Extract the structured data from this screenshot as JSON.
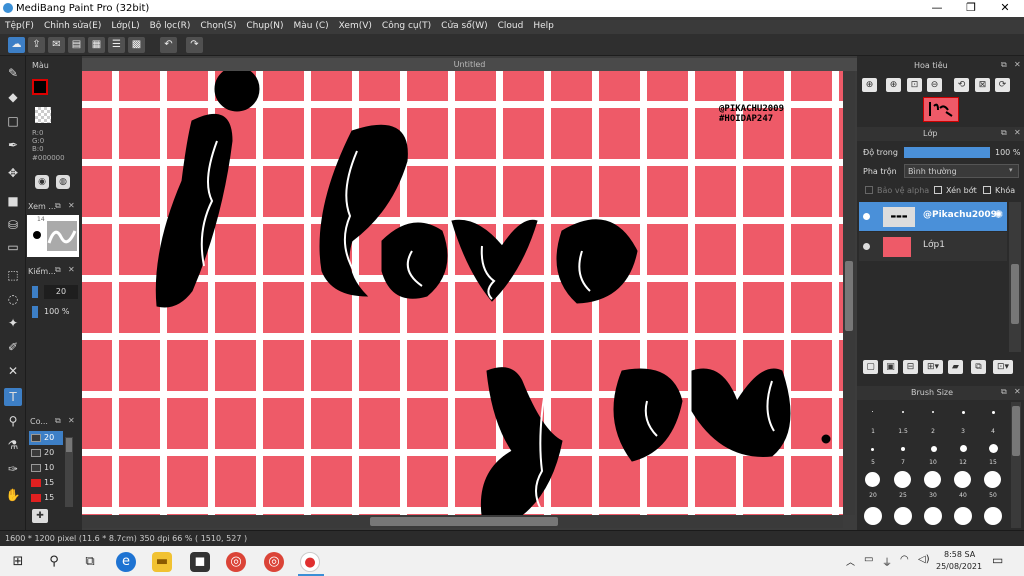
{
  "window": {
    "title": "MediBang Paint Pro (32bit)",
    "minimize": "—",
    "maximize": "❐",
    "close": "✕"
  },
  "menu": [
    "Tệp(F)",
    "Chỉnh sửa(E)",
    "Lớp(L)",
    "Bộ lọc(R)",
    "Chọn(S)",
    "Chụp(N)",
    "Màu (C)",
    "Xem(V)",
    "Công cụ(T)",
    "Cửa sổ(W)",
    "Cloud",
    "Help"
  ],
  "canvas": {
    "tab_title": "Untitled",
    "watermark_line1": "@PIKACHU2009",
    "watermark_line2": "#HOIDAP247"
  },
  "color_panel": {
    "title": "Màu",
    "r": "R:0",
    "g": "G:0",
    "b": "B:0",
    "hex": "#000000"
  },
  "view_panel": {
    "title": "Xem ...",
    "zoom": "14"
  },
  "brush_ctrl": {
    "title": "Kiểm...",
    "size": "20",
    "opacity": "100 %"
  },
  "brushes_panel": {
    "title": "Co...",
    "items": [
      {
        "size": "20",
        "color": "#3a3a3a"
      },
      {
        "size": "20",
        "color": "#3a3a3a"
      },
      {
        "size": "10",
        "color": "#3a3a3a"
      },
      {
        "size": "15",
        "color": "#e02020"
      },
      {
        "size": "15",
        "color": "#e02020"
      }
    ]
  },
  "navigator": {
    "title": "Hoa tiêu"
  },
  "layers": {
    "title": "Lớp",
    "opacity_label": "Độ trong",
    "opacity_value": "100 %",
    "opacity_fraction": 1.0,
    "blend_label": "Pha trộn",
    "blend_value": "Bình thường",
    "protect_alpha": "Bảo vệ alpha",
    "clipping": "Xén bớt",
    "lock": "Khóa",
    "items": [
      {
        "name": "@Pikachu2009",
        "selected": true
      },
      {
        "name": "Lớp1",
        "selected": false
      }
    ]
  },
  "brush_size": {
    "title": "Brush Size",
    "labels": [
      "1",
      "1.5",
      "2",
      "3",
      "4",
      "5",
      "7",
      "10",
      "12",
      "15",
      "20",
      "25",
      "30",
      "40",
      "50"
    ]
  },
  "status": {
    "text": "1600 * 1200 pixel   (11.6 * 8.7cm)   350 dpi   66 %   ( 1510, 527 )"
  },
  "taskbar": {
    "time": "8:58 SA",
    "date": "25/08/2021"
  },
  "colors": {
    "canvas_bg": "#ee5a68",
    "grid": "#ffffff",
    "ink": "#000000",
    "selected_layer": "#4a90d9"
  }
}
